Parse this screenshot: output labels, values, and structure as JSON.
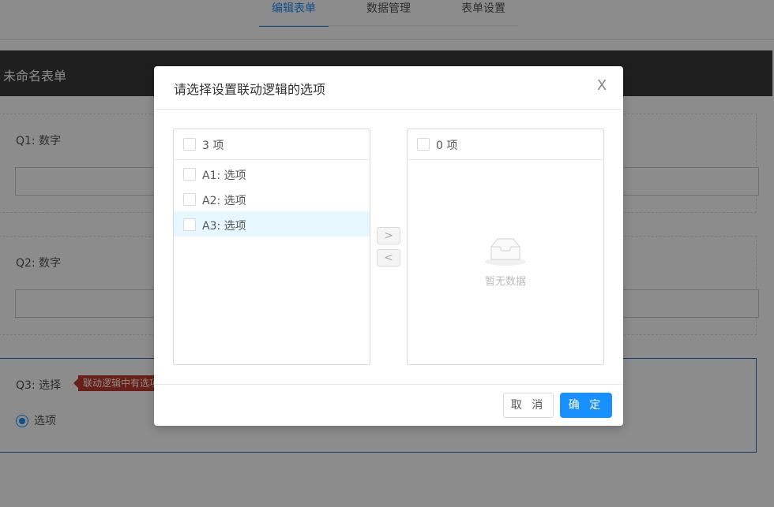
{
  "topnav": {
    "tabs": [
      {
        "label": "编辑表单",
        "active": true
      },
      {
        "label": "数据管理",
        "active": false
      },
      {
        "label": "表单设置",
        "active": false
      }
    ]
  },
  "form": {
    "title": "未命名表单",
    "q1": {
      "label": "Q1: 数字"
    },
    "q2": {
      "label": "Q2: 数字"
    },
    "q3": {
      "label": "Q3: 选择",
      "tag": "联动逻辑中有选项",
      "option": "选项"
    }
  },
  "modal": {
    "title": "请选择设置联动逻辑的选项",
    "close": "X",
    "left_list": {
      "count": "3 项",
      "items": [
        "A1: 选项",
        "A2: 选项",
        "A3: 选项"
      ]
    },
    "right_list": {
      "count": "0 项",
      "empty_text": "暂无数据"
    },
    "move_right": ">",
    "move_left": "<",
    "cancel": "取 消",
    "ok": "确 定"
  },
  "colors": {
    "accent": "#1890ff",
    "tag": "#c0392b",
    "header": "#3a3a3a"
  }
}
